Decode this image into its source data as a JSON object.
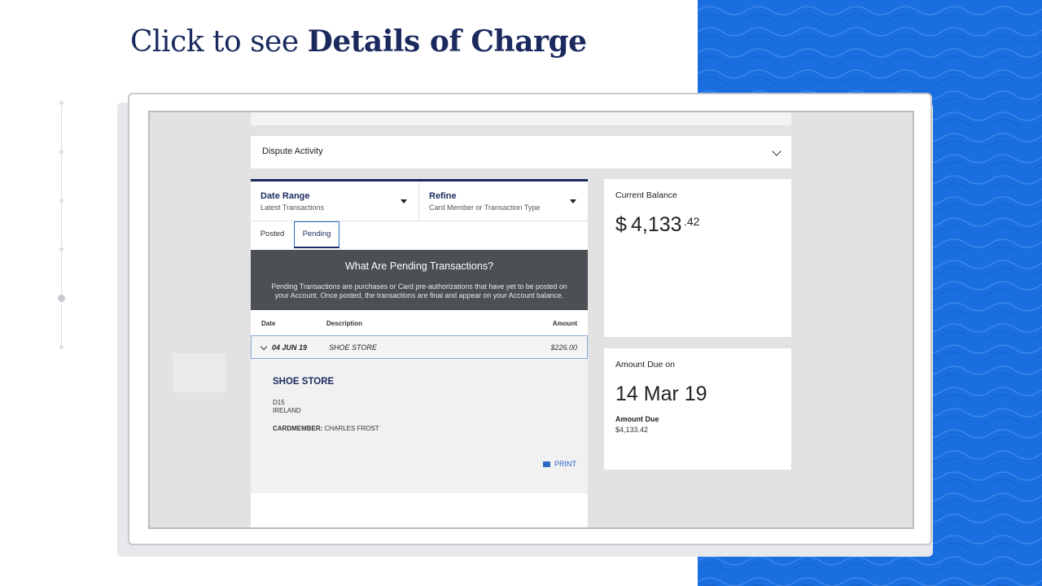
{
  "headline": {
    "light": "Click to see",
    "bold": "Details of Charge"
  },
  "colors": {
    "accent_blue": "#1a6fe0",
    "navy": "#1b2a5e",
    "banner": "#4c4f54"
  },
  "dispute": {
    "label": "Dispute Activity"
  },
  "filters": [
    {
      "title": "Date Range",
      "sub": "Latest Transactions"
    },
    {
      "title": "Refine",
      "sub": "Card Member or Transaction Type"
    }
  ],
  "tabs": {
    "posted": "Posted",
    "pending": "Pending"
  },
  "info": {
    "title": "What Are Pending Transactions?",
    "text": "Pending Transactions are purchases or Card pre-authorizations that have yet to be posted on your Account. Once posted, the transactions are final and appear on your Account balance."
  },
  "columns": {
    "date": "Date",
    "description": "Description",
    "amount": "Amount"
  },
  "transaction": {
    "date": "04 JUN 19",
    "description": "SHOE STORE",
    "amount": "$226.00"
  },
  "detail": {
    "merchant": "SHOE STORE",
    "address_line1": "D15",
    "address_line2": "IRELAND",
    "cardmember_label": "CARDMEMBER:",
    "cardmember_name": "CHARLES FROST",
    "print_label": "PRINT"
  },
  "balance": {
    "label": "Current Balance",
    "dollar_sign": "$",
    "amount": "4,133",
    "cents": ".42"
  },
  "due": {
    "label": "Amount Due on",
    "date": "14 Mar 19",
    "sub_label": "Amount Due",
    "amount": "$4,133.42"
  }
}
